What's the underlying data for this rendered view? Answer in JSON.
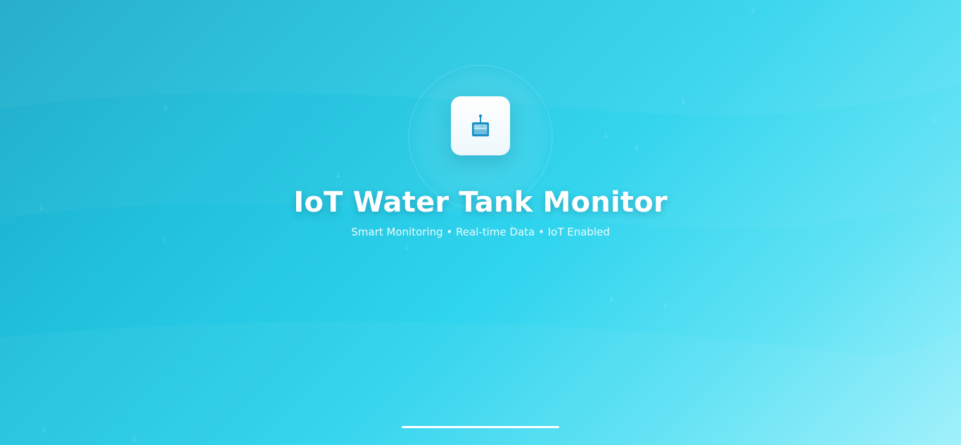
{
  "splash": {
    "title": "IoT Water Tank Monitor",
    "subtitle": "Smart Monitoring • Real-time Data • IoT Enabled",
    "logo_icon": "water-tank-icon",
    "decorative_icon": "water-droplet-icon"
  },
  "loading": {
    "progress": 1.0
  },
  "colors": {
    "background_start": "#19a9c9",
    "background_end": "#9df1fb",
    "logo_accent": "#1a8fc4",
    "text": "#ffffff"
  }
}
